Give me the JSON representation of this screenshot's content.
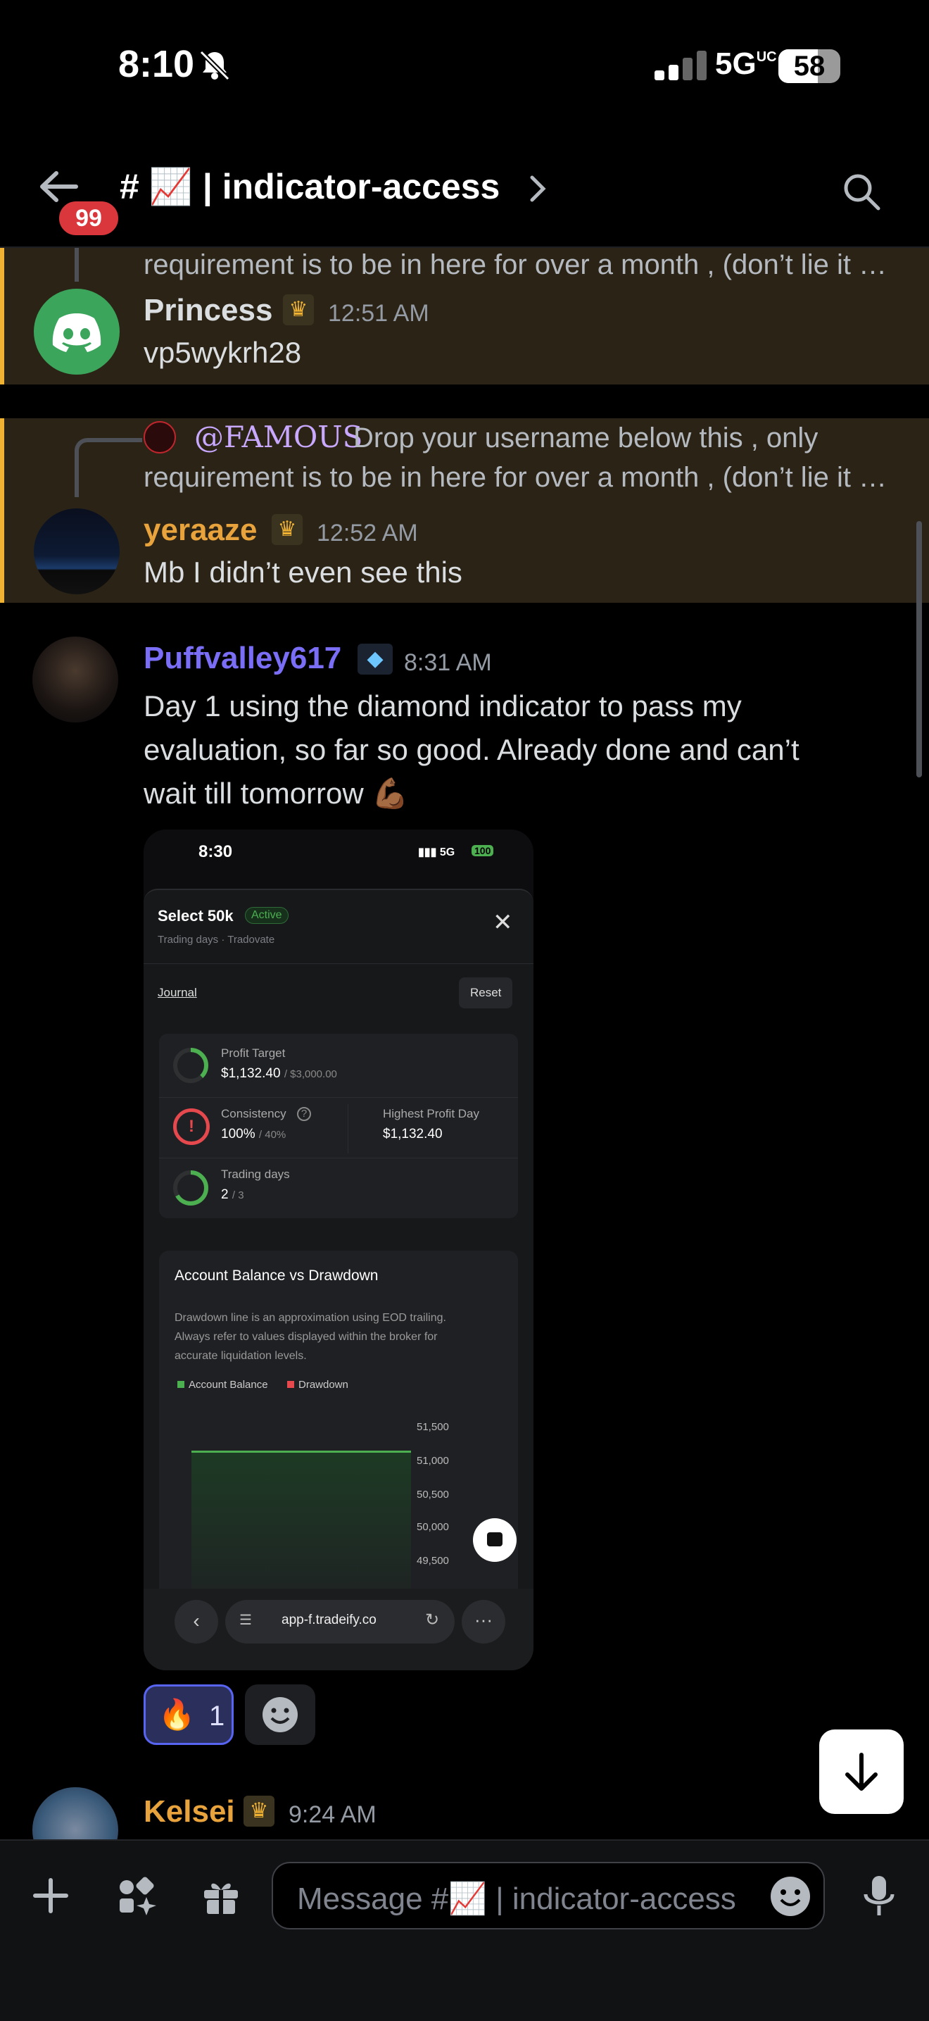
{
  "status_bar": {
    "time": "8:10",
    "network": "5G",
    "network_sup": "UC",
    "battery": "58"
  },
  "header": {
    "unread_badge": "99",
    "channel_name": "# 📈 | indicator-access"
  },
  "messages": [
    {
      "reply_snippet": "requirement is to be in here for over a month , (don’t lie it …",
      "author": "Princess",
      "author_color": "#e8a33d",
      "timestamp": "12:51 AM",
      "text": "vp5wykrh28"
    },
    {
      "reply_mention": "@FAMOUS",
      "reply_line1": "Drop your username below this , only",
      "reply_line2": "requirement is to be in here for over a month , (don’t lie it …",
      "author": "yeraaze",
      "author_color": "#e8a33d",
      "timestamp": "12:52 AM",
      "text": "Mb I didn’t even see this"
    },
    {
      "author": "Puffvalley617",
      "author_color": "#7b6ef6",
      "timestamp": "8:31 AM",
      "text_lines": [
        "Day 1 using the diamond indicator to pass my",
        "evaluation, so far so good. Already done and can’t",
        "wait till tomorrow 💪🏾"
      ]
    },
    {
      "author": "Kelsei",
      "author_color": "#e8a33d",
      "timestamp": "9:24 AM"
    }
  ],
  "embed": {
    "time": "8:30",
    "network": "5G",
    "battery": "100",
    "panel_title": "Select 50k",
    "status": "Active",
    "subtitle": "Trading days · Tradovate",
    "journal_link": "Journal",
    "reset_button": "Reset",
    "profit_target_label": "Profit Target",
    "profit_target_value": "$1,132.40",
    "profit_target_goal": "/ $3,000.00",
    "profit_target_progress": 0.377,
    "consistency_label": "Consistency",
    "consistency_value": "100%",
    "consistency_goal": "/ 40%",
    "highest_day_label": "Highest Profit Day",
    "highest_day_value": "$1,132.40",
    "trading_days_label": "Trading days",
    "trading_days_value": "2",
    "trading_days_goal": "/ 3",
    "trading_days_progress": 0.667,
    "chart_title": "Account Balance vs Drawdown",
    "chart_note": [
      "Drawdown line is an approximation using EOD trailing.",
      "Always refer to values displayed within the broker for",
      "accurate liquidation levels."
    ],
    "legend_balance": "Account Balance",
    "legend_drawdown": "Drawdown",
    "y_ticks": [
      "51,500",
      "51,000",
      "50,500",
      "50,000",
      "49,500"
    ],
    "url": "app-f.tradeify.co"
  },
  "reactions": [
    {
      "emoji": "🔥",
      "count": "1"
    }
  ],
  "composer": {
    "placeholder": "Message #📈 | indicator-access"
  },
  "colors": {
    "highlight_bg": "#2b2416",
    "highlight_border": "#f0b232",
    "accent": "#5865f2",
    "badge": "#da373c"
  }
}
